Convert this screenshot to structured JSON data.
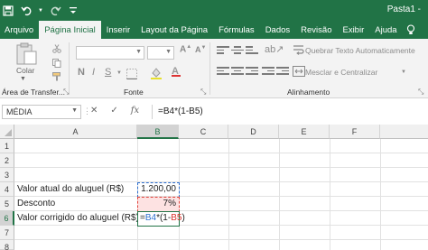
{
  "window": {
    "title": "Pasta1 -"
  },
  "tabs": [
    {
      "label": "Arquivo"
    },
    {
      "label": "Página Inicial"
    },
    {
      "label": "Inserir"
    },
    {
      "label": "Layout da Página"
    },
    {
      "label": "Fórmulas"
    },
    {
      "label": "Dados"
    },
    {
      "label": "Revisão"
    },
    {
      "label": "Exibir"
    },
    {
      "label": "Ajuda"
    }
  ],
  "active_tab": "Página Inicial",
  "ribbon": {
    "paste_label": "Colar",
    "groups": {
      "clipboard": "Área de Transfer...",
      "font": "Fonte",
      "alignment": "Alinhamento"
    },
    "wrap_text": "Quebrar Texto Automaticamente",
    "merge_center": "Mesclar e Centralizar",
    "bold": "N",
    "italic": "I",
    "underline": "S"
  },
  "formula_bar": {
    "name_box": "MÉDIA",
    "cancel_icon": "✕",
    "enter_icon": "✓",
    "fx_label": "fx",
    "formula": "=B4*(1-B5)"
  },
  "grid": {
    "columns": [
      "A",
      "B",
      "C",
      "D",
      "E",
      "F"
    ],
    "selected_column": "B",
    "rows": [
      "1",
      "2",
      "3",
      "4",
      "5",
      "6",
      "7",
      "8"
    ],
    "selected_row": "6",
    "cells": {
      "A4": "Valor atual do aluguel (R$)",
      "B4": "1.200,00",
      "A5": "Desconto",
      "B5": "7%",
      "A6": "Valor corrigido do aluguel (R$)"
    },
    "editing_formula": {
      "prefix": "=",
      "ref1": "B4",
      "middle": "*(1-",
      "ref2": "B5",
      "suffix": ")"
    }
  },
  "colors": {
    "excel_green": "#217346",
    "ref_blue": "#2e6fcf",
    "ref_red": "#e0443c"
  }
}
